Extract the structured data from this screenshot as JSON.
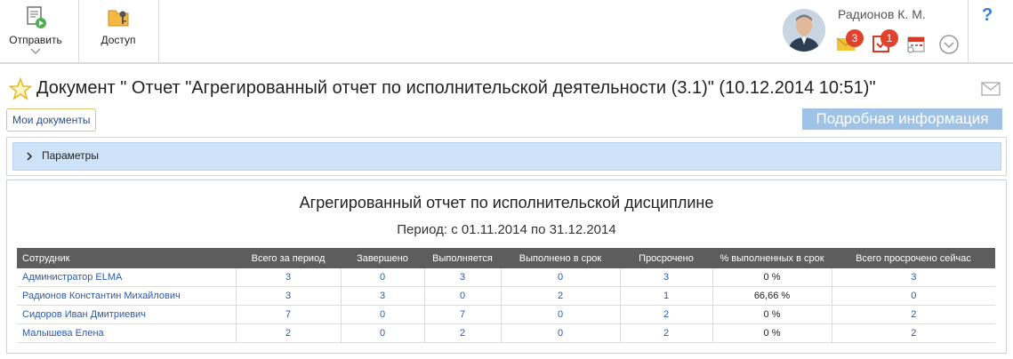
{
  "toolbar": {
    "send_label": "Отправить",
    "access_label": "Доступ"
  },
  "user": {
    "name": "Радионов К. М.",
    "messages_badge": "3",
    "tasks_badge": "1"
  },
  "help_label": "?",
  "document": {
    "title": "Документ \" Отчет \"Агрегированный отчет по исполнительской деятельности (3.1)\" (10.12.2014 10:51)\""
  },
  "nav": {
    "my_documents": "Мои документы",
    "details_tab": "Подробная информация"
  },
  "params": {
    "label": "Параметры"
  },
  "report": {
    "title": "Агрегированный отчет по исполнительской дисциплине",
    "period": "Период: с 01.11.2014 по 31.12.2014",
    "columns": [
      "Сотрудник",
      "Всего за период",
      "Завершено",
      "Выполняется",
      "Выполнено в срок",
      "Просрочено",
      "% выполненных в срок",
      "Всего просрочено сейчас"
    ],
    "rows": [
      [
        "Администратор ELMA",
        "3",
        "0",
        "3",
        "0",
        "3",
        "0 %",
        "3"
      ],
      [
        "Радионов Константин Михайлович",
        "3",
        "3",
        "0",
        "2",
        "1",
        "66,66 %",
        "0"
      ],
      [
        "Сидоров Иван Дмитриевич",
        "7",
        "0",
        "7",
        "0",
        "2",
        "0 %",
        "2"
      ],
      [
        "Малышева Елена",
        "2",
        "0",
        "2",
        "0",
        "2",
        "0 %",
        "2"
      ]
    ]
  },
  "colors": {
    "accent": "#9ec3e6",
    "header_bg": "#5d5d5d",
    "link": "#2a5aa8",
    "badge": "#e2412b"
  }
}
